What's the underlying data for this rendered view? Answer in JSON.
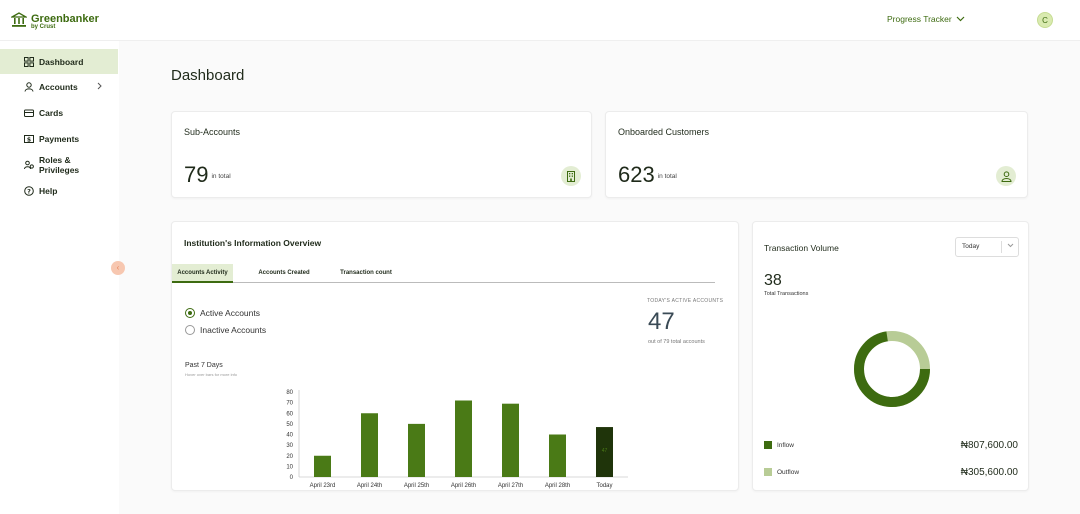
{
  "brand": {
    "name": "Greenbanker",
    "sub": "by Crust"
  },
  "topbar": {
    "tracker": "Progress Tracker",
    "avatar": "C"
  },
  "sidebar": {
    "items": [
      {
        "label": "Dashboard",
        "icon": "grid-icon",
        "active": true
      },
      {
        "label": "Accounts",
        "icon": "user-icon",
        "has_chevron": true
      },
      {
        "label": "Cards",
        "icon": "card-icon"
      },
      {
        "label": "Payments",
        "icon": "payments-icon"
      },
      {
        "label": "Roles & Privileges",
        "icon": "roles-icon"
      },
      {
        "label": "Help",
        "icon": "help-icon"
      }
    ]
  },
  "page": {
    "title": "Dashboard"
  },
  "cards": {
    "sub_accounts": {
      "label": "Sub-Accounts",
      "value": "79",
      "suffix": "in total",
      "icon": "building-icon"
    },
    "onboarded": {
      "label": "Onboarded Customers",
      "value": "623",
      "suffix": "in total",
      "icon": "users-icon"
    }
  },
  "overview": {
    "title": "Institution's Information Overview",
    "tabs": [
      "Accounts Activity",
      "Accounts Created",
      "Transaction count"
    ],
    "active_tab": 0,
    "radios": [
      {
        "label": "Active Accounts",
        "selected": true
      },
      {
        "label": "Inactive Accounts",
        "selected": false
      }
    ],
    "today_label": "TODAY'S ACTIVE ACCOUNTS",
    "today_value": "47",
    "today_sub": "out of 79 total accounts",
    "past_label": "Past 7 Days",
    "past_hint": "Hover over bars for more info"
  },
  "chart_data": {
    "type": "bar",
    "categories": [
      "April 23rd",
      "April 24th",
      "April 25th",
      "April 26th",
      "April 27th",
      "April 28th",
      "Today"
    ],
    "values": [
      20,
      60,
      50,
      72,
      69,
      40,
      47
    ],
    "ylim": [
      0,
      80
    ],
    "yticks": [
      0,
      10,
      20,
      30,
      40,
      50,
      60,
      70,
      80
    ],
    "colors": {
      "bar": "#4a7a16",
      "highlight": "#1f340a"
    },
    "highlight_label": "47"
  },
  "volume": {
    "title": "Transaction Volume",
    "period": "Today",
    "total": "38",
    "total_label": "Total Transactions",
    "donut": {
      "inflow_fraction": 0.725,
      "inflow_color": "#3d6b10",
      "outflow_color": "#b8cc96"
    },
    "legend": [
      {
        "label": "Inflow",
        "amount": "₦807,600.00",
        "color": "#3d6b10"
      },
      {
        "label": "Outflow",
        "amount": "₦305,600.00",
        "color": "#b8cc96"
      }
    ]
  }
}
